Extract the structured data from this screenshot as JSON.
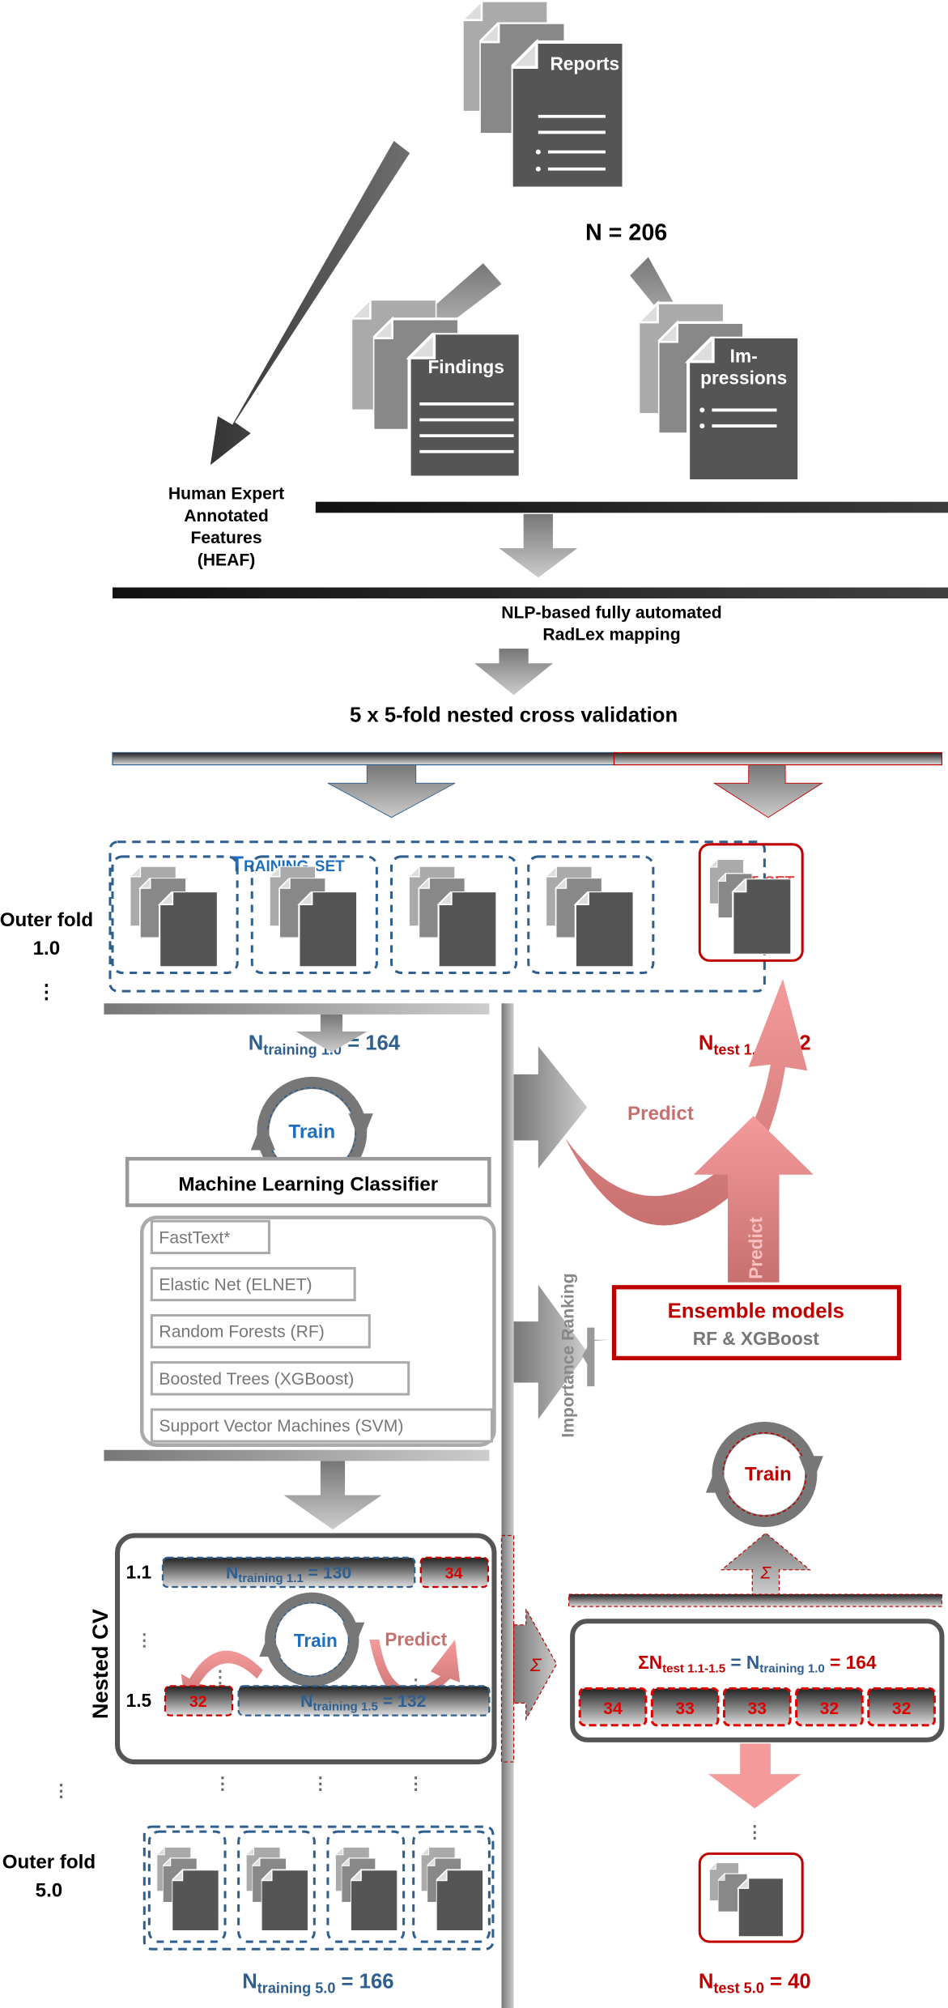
{
  "top": {
    "reports_label": "Reports",
    "n_total": "N = 206",
    "findings_label": "Findings",
    "impressions_label_1": "Im-",
    "impressions_label_2": "pressions",
    "heaf_lines": [
      "Human Expert",
      "Annotated",
      "Features",
      "(HEAF)"
    ],
    "nlp_lines": [
      "NLP-based fully automated",
      "RadLex mapping"
    ],
    "cv_title": "5 x 5-fold nested cross validation"
  },
  "training_set_title": "Training set",
  "test_set_title": "Test set",
  "outer_fold_1": {
    "label_1": "Outer fold",
    "label_2": "1.0",
    "n_train": {
      "n": "N",
      "sub": "training 1.0",
      "val": " = 164"
    },
    "n_test": {
      "n": "N",
      "sub": "test 1.0",
      "val": " = 42"
    }
  },
  "outer_fold_5": {
    "label_1": "Outer fold",
    "label_2": "5.0",
    "n_train": {
      "n": "N",
      "sub": "training 5.0",
      "val": " = 166"
    },
    "n_test": {
      "n": "N",
      "sub": "test 5.0",
      "val": " = 40"
    }
  },
  "train_label": "Train",
  "predict_label": "Predict",
  "ml_classifier_title": "Machine Learning Classifier",
  "classifiers": [
    "FastText*",
    "Elastic Net (ELNET)",
    "Random Forests (RF)",
    "Boosted Trees (XGBoost)",
    "Support Vector Machines (SVM)"
  ],
  "importance_ranking": "Importance Ranking",
  "ensemble": {
    "title": "Ensemble models",
    "subtitle": "RF & XGBoost"
  },
  "nested_cv": {
    "label": "Nested CV",
    "row_first": {
      "id": "1.1",
      "n": "N",
      "sub": "training 1.1",
      "val": " = 130",
      "test": "34"
    },
    "row_last": {
      "id": "1.5",
      "n": "N",
      "sub": "training 1.5",
      "val": " = 132",
      "test": "32"
    }
  },
  "sigma": "Σ",
  "sum_formula": {
    "a": "ΣN",
    "a_sub": "test 1.1-1.5",
    "eq1": " = ",
    "b": "N",
    "b_sub": "training 1.0",
    "eq2": " = 164"
  },
  "test_counts": [
    "34",
    "33",
    "33",
    "32",
    "32"
  ],
  "ellipsis": "⋮",
  "colors": {
    "training_blue": "#1f6fbf",
    "label_blue": "#2e5f8f",
    "test_red": "#c00000",
    "test_title_red": "#e05050",
    "predict_pink": "#f08c8c",
    "doc_gray": "#555555"
  }
}
